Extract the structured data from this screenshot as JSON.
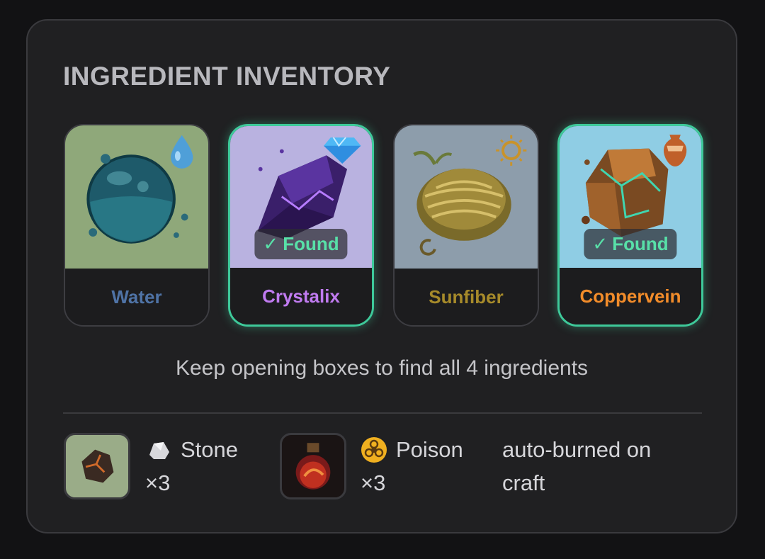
{
  "title": "INGREDIENT INVENTORY",
  "ingredients": [
    {
      "name": "Water",
      "found": false,
      "name_color": "#4f73a6",
      "art_bg": "#8fa87a",
      "icon": "water-orb-icon",
      "corner_icon": "water-drop-icon"
    },
    {
      "name": "Crystalix",
      "found": true,
      "name_color": "#c07bf0",
      "art_bg": "#b9b2e0",
      "icon": "purple-crystal-icon",
      "corner_icon": "diamond-icon"
    },
    {
      "name": "Sunfiber",
      "found": false,
      "name_color": "#a68a2a",
      "art_bg": "#8d9dab",
      "icon": "fiber-nest-icon",
      "corner_icon": "sun-icon"
    },
    {
      "name": "Coppervein",
      "found": true,
      "name_color": "#f28c2a",
      "art_bg": "#8fcde4",
      "icon": "copper-rock-icon",
      "corner_icon": "amphora-icon"
    }
  ],
  "found_badge": {
    "check": "✓",
    "label": "Found"
  },
  "hint": "Keep opening boxes to find all 4 ingredients",
  "waste": [
    {
      "name": "Stone",
      "count": "×3",
      "icon": "stone-icon",
      "badge_icon": "rock-icon"
    },
    {
      "name": "Poison",
      "count": "×3",
      "icon": "poison-potion-icon",
      "badge_icon": "biohazard-icon"
    }
  ],
  "auto_burn_note": "auto-burned on craft"
}
